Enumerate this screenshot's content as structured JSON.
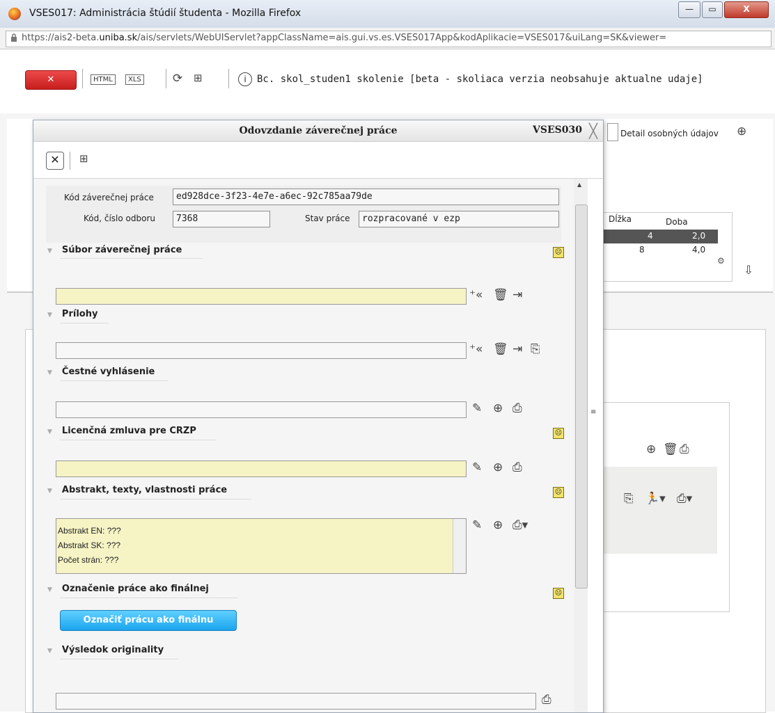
{
  "window": {
    "title": "VSES017: Administrácia štúdií študenta - Mozilla Firefox",
    "url_prefix": "https://ais2-beta.",
    "url_host": "uniba.sk",
    "url_suffix": "/ais/servlets/WebUIServlet?appClassName=ais.gui.vs.es.VSES017App&kodAplikacie=VSES017&uiLang=SK&viewer="
  },
  "toolbar": {
    "close_label": "✕",
    "html_label": "HTML",
    "xls_label": "XLS",
    "info_text": "Bc. skol_studen1 skolenie [beta - skoliaca verzia neobsahuje aktualne udaje]"
  },
  "background": {
    "detail_label": "Detail osobných údajov",
    "col_dlzka": "Dĺžka",
    "col_doba": "Doba",
    "row1": {
      "dlzka": "4",
      "doba": "2,0"
    },
    "row2": {
      "dlzka": "8",
      "doba": "4,0"
    }
  },
  "dialog": {
    "title": "Odovzdanie záverečnej práce",
    "code": "VSES030",
    "kod_label": "Kód záverečnej práce",
    "kod_value": "ed928dce-3f23-4e7e-a6ec-92c785aa79de",
    "odbor_label": "Kód, číslo odboru",
    "odbor_value": "7368",
    "stav_label": "Stav práce",
    "stav_value": "rozpracované v ezp",
    "sections": {
      "subor": "Súbor záverečnej práce",
      "prilohy": "Prílohy",
      "cestne": "Čestné vyhlásenie",
      "licencna": "Licenčná zmluva pre CRZP",
      "abstrakt": "Abstrakt, texty, vlastnosti práce",
      "oznacenie": "Označenie práce ako finálnej",
      "vysledok": "Výsledok originality"
    },
    "abstract_lines": [
      "Abstrakt EN: ???",
      "Abstrakt SK: ???",
      "Počet strán: ???"
    ],
    "final_button": "Označiť prácu ako finálnu"
  }
}
